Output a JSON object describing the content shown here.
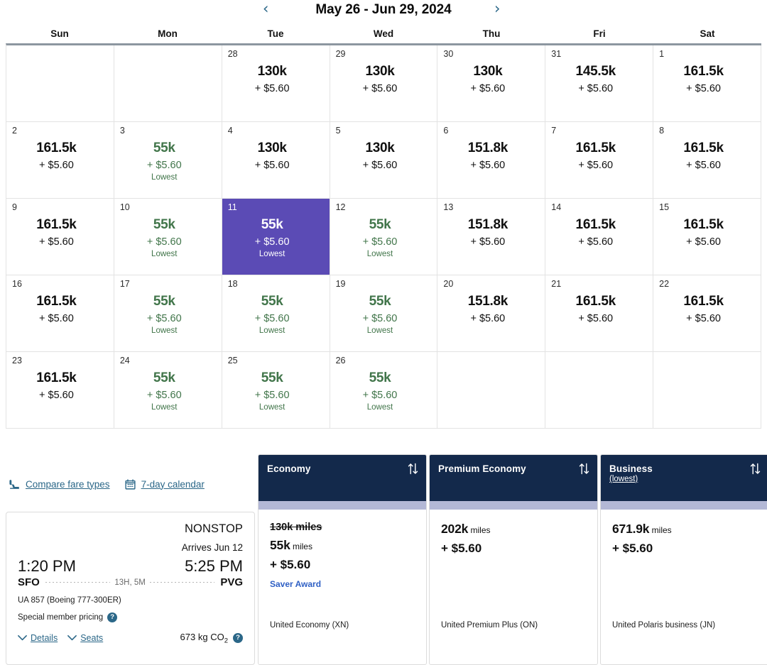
{
  "calendar": {
    "title": "May 26 - Jun 29, 2024",
    "prev_label": "‹",
    "next_label": "›",
    "weekdays": [
      "Sun",
      "Mon",
      "Tue",
      "Wed",
      "Thu",
      "Fri",
      "Sat"
    ],
    "lowest_label": "Lowest",
    "cells": [
      {
        "day": "",
        "miles": "",
        "fee": "",
        "lowest": "",
        "state": "empty"
      },
      {
        "day": "",
        "miles": "",
        "fee": "",
        "lowest": "",
        "state": "empty"
      },
      {
        "day": "28",
        "miles": "130k",
        "fee": "+ $5.60",
        "lowest": "",
        "state": "std"
      },
      {
        "day": "29",
        "miles": "130k",
        "fee": "+ $5.60",
        "lowest": "",
        "state": "std"
      },
      {
        "day": "30",
        "miles": "130k",
        "fee": "+ $5.60",
        "lowest": "",
        "state": "std"
      },
      {
        "day": "31",
        "miles": "145.5k",
        "fee": "+ $5.60",
        "lowest": "",
        "state": "std"
      },
      {
        "day": "1",
        "miles": "161.5k",
        "fee": "+ $5.60",
        "lowest": "",
        "state": "std"
      },
      {
        "day": "2",
        "miles": "161.5k",
        "fee": "+ $5.60",
        "lowest": "",
        "state": "std"
      },
      {
        "day": "3",
        "miles": "55k",
        "fee": "+ $5.60",
        "lowest": "Lowest",
        "state": "green"
      },
      {
        "day": "4",
        "miles": "130k",
        "fee": "+ $5.60",
        "lowest": "",
        "state": "std"
      },
      {
        "day": "5",
        "miles": "130k",
        "fee": "+ $5.60",
        "lowest": "",
        "state": "std"
      },
      {
        "day": "6",
        "miles": "151.8k",
        "fee": "+ $5.60",
        "lowest": "",
        "state": "std"
      },
      {
        "day": "7",
        "miles": "161.5k",
        "fee": "+ $5.60",
        "lowest": "",
        "state": "std"
      },
      {
        "day": "8",
        "miles": "161.5k",
        "fee": "+ $5.60",
        "lowest": "",
        "state": "std"
      },
      {
        "day": "9",
        "miles": "161.5k",
        "fee": "+ $5.60",
        "lowest": "",
        "state": "std"
      },
      {
        "day": "10",
        "miles": "55k",
        "fee": "+ $5.60",
        "lowest": "Lowest",
        "state": "green"
      },
      {
        "day": "11",
        "miles": "55k",
        "fee": "+ $5.60",
        "lowest": "Lowest",
        "state": "selected"
      },
      {
        "day": "12",
        "miles": "55k",
        "fee": "+ $5.60",
        "lowest": "Lowest",
        "state": "green"
      },
      {
        "day": "13",
        "miles": "151.8k",
        "fee": "+ $5.60",
        "lowest": "",
        "state": "std"
      },
      {
        "day": "14",
        "miles": "161.5k",
        "fee": "+ $5.60",
        "lowest": "",
        "state": "std"
      },
      {
        "day": "15",
        "miles": "161.5k",
        "fee": "+ $5.60",
        "lowest": "",
        "state": "std"
      },
      {
        "day": "16",
        "miles": "161.5k",
        "fee": "+ $5.60",
        "lowest": "",
        "state": "std"
      },
      {
        "day": "17",
        "miles": "55k",
        "fee": "+ $5.60",
        "lowest": "Lowest",
        "state": "green"
      },
      {
        "day": "18",
        "miles": "55k",
        "fee": "+ $5.60",
        "lowest": "Lowest",
        "state": "green"
      },
      {
        "day": "19",
        "miles": "55k",
        "fee": "+ $5.60",
        "lowest": "Lowest",
        "state": "green"
      },
      {
        "day": "20",
        "miles": "151.8k",
        "fee": "+ $5.60",
        "lowest": "",
        "state": "std"
      },
      {
        "day": "21",
        "miles": "161.5k",
        "fee": "+ $5.60",
        "lowest": "",
        "state": "std"
      },
      {
        "day": "22",
        "miles": "161.5k",
        "fee": "+ $5.60",
        "lowest": "",
        "state": "std"
      },
      {
        "day": "23",
        "miles": "161.5k",
        "fee": "+ $5.60",
        "lowest": "",
        "state": "std"
      },
      {
        "day": "24",
        "miles": "55k",
        "fee": "+ $5.60",
        "lowest": "Lowest",
        "state": "green"
      },
      {
        "day": "25",
        "miles": "55k",
        "fee": "+ $5.60",
        "lowest": "Lowest",
        "state": "green"
      },
      {
        "day": "26",
        "miles": "55k",
        "fee": "+ $5.60",
        "lowest": "Lowest",
        "state": "green"
      },
      {
        "day": "",
        "miles": "",
        "fee": "",
        "lowest": "",
        "state": "empty"
      },
      {
        "day": "",
        "miles": "",
        "fee": "",
        "lowest": "",
        "state": "empty"
      },
      {
        "day": "",
        "miles": "",
        "fee": "",
        "lowest": "",
        "state": "empty"
      }
    ]
  },
  "links": {
    "compare": {
      "label": "Compare fare types",
      "icon": "airplane-seat-icon"
    },
    "seven_day": {
      "label": "7-day calendar",
      "icon": "calendar-icon"
    }
  },
  "flight": {
    "nonstop": "NONSTOP",
    "arrives": "Arrives Jun 12",
    "depart_time": "1:20 PM",
    "arrive_time": "5:25 PM",
    "origin": "SFO",
    "destination": "PVG",
    "duration": "13H, 5M",
    "flight_number": "UA 857 (Boeing 777-300ER)",
    "member_pricing": "Special member pricing",
    "details_label": "Details",
    "seats_label": "Seats",
    "co2": "673 kg CO",
    "co2_sub": "2",
    "help_label": "?"
  },
  "fares": [
    {
      "name": "Economy",
      "sub": "",
      "struck_miles": "130k miles",
      "miles_value": "55k",
      "miles_word": "miles",
      "fee": "+ $5.60",
      "tag": "Saver Award",
      "cabin": "United Economy (XN)",
      "sort_icon": "sort-updown-icon"
    },
    {
      "name": "Premium Economy",
      "sub": "",
      "struck_miles": "",
      "miles_value": "202k",
      "miles_word": "miles",
      "fee": "+ $5.60",
      "tag": "",
      "cabin": "United Premium Plus (ON)",
      "sort_icon": "sort-updown-icon"
    },
    {
      "name": "Business",
      "sub": "(lowest)",
      "struck_miles": "",
      "miles_value": "671.9k",
      "miles_word": "miles",
      "fee": "+ $5.60",
      "tag": "",
      "cabin": "United Polaris business (JN)",
      "sort_icon": "sort-updown-icon"
    }
  ],
  "colors": {
    "selected_purple": "#5b4bb5",
    "lowest_green": "#41754a",
    "navy": "#13294b",
    "lavender": "#b3b8d6",
    "link_blue": "#2b6788",
    "tag_blue": "#2e5fc4"
  }
}
